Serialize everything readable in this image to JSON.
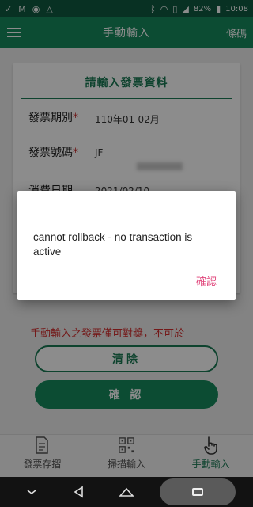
{
  "status_bar": {
    "battery": "82%",
    "time": "10:08",
    "icons_left": [
      "check-icon",
      "gmail-icon",
      "pin-icon",
      "drive-icon"
    ],
    "icons_right": [
      "bluetooth-icon",
      "wifi-icon",
      "sim-icon",
      "signal-icon",
      "battery-icon"
    ]
  },
  "app_bar": {
    "title": "手動輸入",
    "right_action": "條碼"
  },
  "form": {
    "title": "請輸入發票資料",
    "period_label": "發票期別",
    "period_value": "110年01-02月",
    "number_label": "發票號碼",
    "number_prefix": "JF",
    "date_label": "消費日期",
    "date_value": "2021/02/10",
    "required_marker": "*"
  },
  "warning_text": "手動輸入之發票僅可對獎，不可於",
  "buttons": {
    "clear": "清除",
    "confirm": "確 認"
  },
  "bottom_nav": [
    {
      "label": "發票存摺",
      "icon": "document-icon"
    },
    {
      "label": "掃描輸入",
      "icon": "qr-code-icon"
    },
    {
      "label": "手動輸入",
      "icon": "hand-pointer-icon"
    }
  ],
  "dialog": {
    "message": "cannot rollback - no transaction is active",
    "ok_label": "確認"
  },
  "colors": {
    "primary": "#178a5e",
    "status_bar": "#0f5a40",
    "warning": "#d32f2f",
    "dialog_accent": "#e0457b"
  }
}
